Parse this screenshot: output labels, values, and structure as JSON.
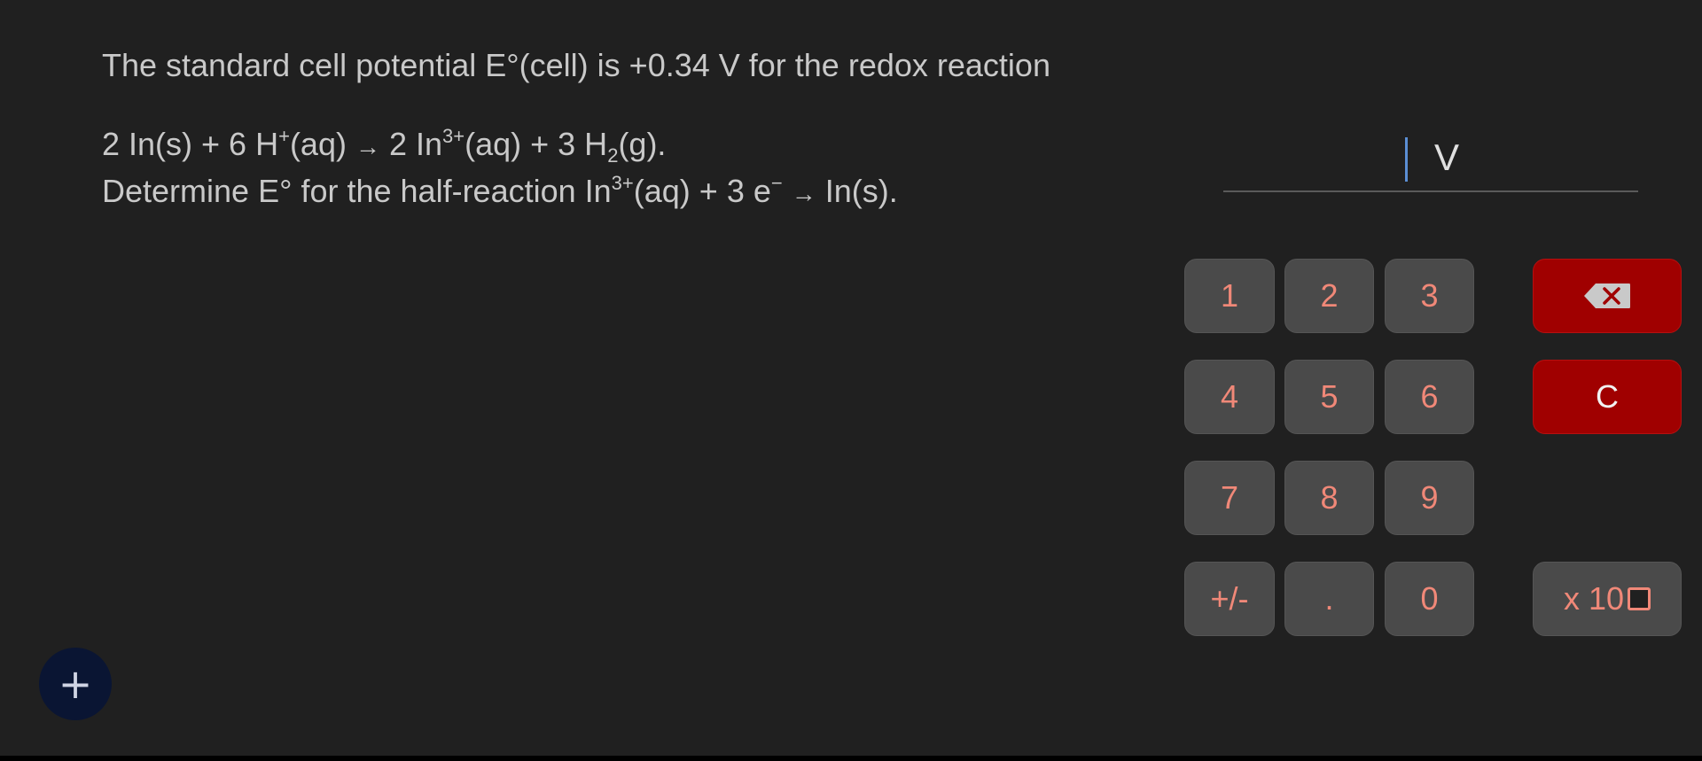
{
  "question": {
    "line1": "The standard cell potential E°(cell) is +0.34 V for the redox reaction",
    "eq_lhs": "2 In(s) + 6 H",
    "eq_lhs_sup": "+",
    "eq_lhs_tail": "(aq)",
    "arrow": "→",
    "eq_rhs_a": "2 In",
    "eq_rhs_sup": "3+",
    "eq_rhs_b": "(aq) + 3 H",
    "eq_rhs_sub": "2",
    "eq_rhs_c": "(g).",
    "line3_a": "Determine E° for the half-reaction In",
    "line3_sup": "3+",
    "line3_b": "(aq) + 3 e",
    "line3_sup2": "−",
    "line3_arrow": "→",
    "line3_c": "In(s)."
  },
  "answer": {
    "value": "",
    "unit": "V"
  },
  "keypad": {
    "k1": "1",
    "k2": "2",
    "k3": "3",
    "k4": "4",
    "k5": "5",
    "k6": "6",
    "k7": "7",
    "k8": "8",
    "k9": "9",
    "sign": "+/-",
    "dot": ".",
    "k0": "0",
    "clear": "C",
    "exp": "x 10",
    "backspace_icon": "backspace-icon"
  },
  "fab": {
    "label": "+"
  },
  "colors": {
    "background": "#202020",
    "key": "#4a4a4a",
    "key_text": "#f08878",
    "danger": "#a00000",
    "caret": "#5b8fd4",
    "fab": "#0a1533"
  }
}
